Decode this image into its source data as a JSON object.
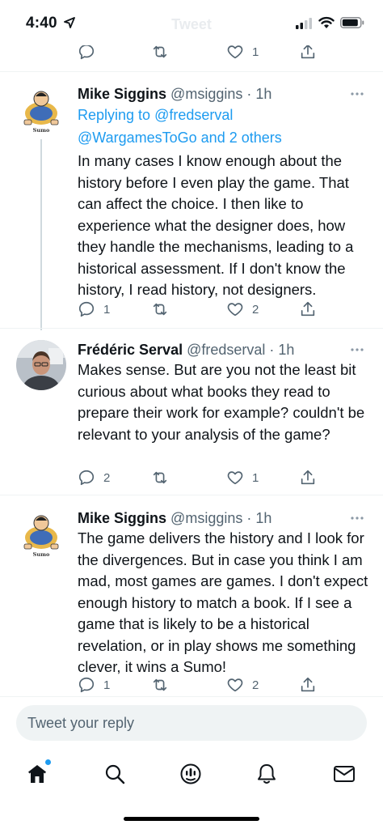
{
  "status_bar": {
    "time": "4:40"
  },
  "header": {
    "title": "Tweet"
  },
  "top_actions": {
    "like_count": "1"
  },
  "tweets": [
    {
      "name": "Mike Siggins",
      "handle": "@msiggins",
      "sep": "·",
      "time": "1h",
      "replying_prefix": "Replying to",
      "replying_user": "@fredserval",
      "replying_user2": "@WargamesToGo",
      "replying_others": "and 2 others",
      "text": "In many cases I know enough about the history before I even play the game. That can affect the choice. I then like to experience what the designer does, how they handle the mechanisms, leading to a historical assessment. If I don't know the history, I read history, not designers.",
      "reply_count": "1",
      "retweet_count": "",
      "like_count": "2"
    },
    {
      "name": "Frédéric Serval",
      "handle": "@fredserval",
      "sep": "·",
      "time": "1h",
      "text": "Makes sense. But are you not the least bit curious about what books they read to prepare their work for example? couldn't be relevant to your analysis of the game?",
      "reply_count": "2",
      "retweet_count": "",
      "like_count": "1"
    },
    {
      "name": "Mike Siggins",
      "handle": "@msiggins",
      "sep": "·",
      "time": "1h",
      "text": "The game delivers the history and I look for the divergences. But in case you think I am mad, most games are games. I don't expect enough history to match a book. If I see a game that is likely to be a historical revelation, or in play shows me something clever, it wins a Sumo!",
      "reply_count": "1",
      "retweet_count": "",
      "like_count": "2"
    }
  ],
  "avatar_caption": "Sumo",
  "reply_box": {
    "placeholder": "Tweet your reply"
  },
  "tabbar": {
    "items": [
      "home-icon",
      "search-icon",
      "spaces-icon",
      "notifications-icon",
      "messages-icon"
    ]
  },
  "colors": {
    "accent": "#1d9bf0",
    "text": "#0f1419",
    "secondary": "#536471",
    "border": "#eff3f4"
  }
}
